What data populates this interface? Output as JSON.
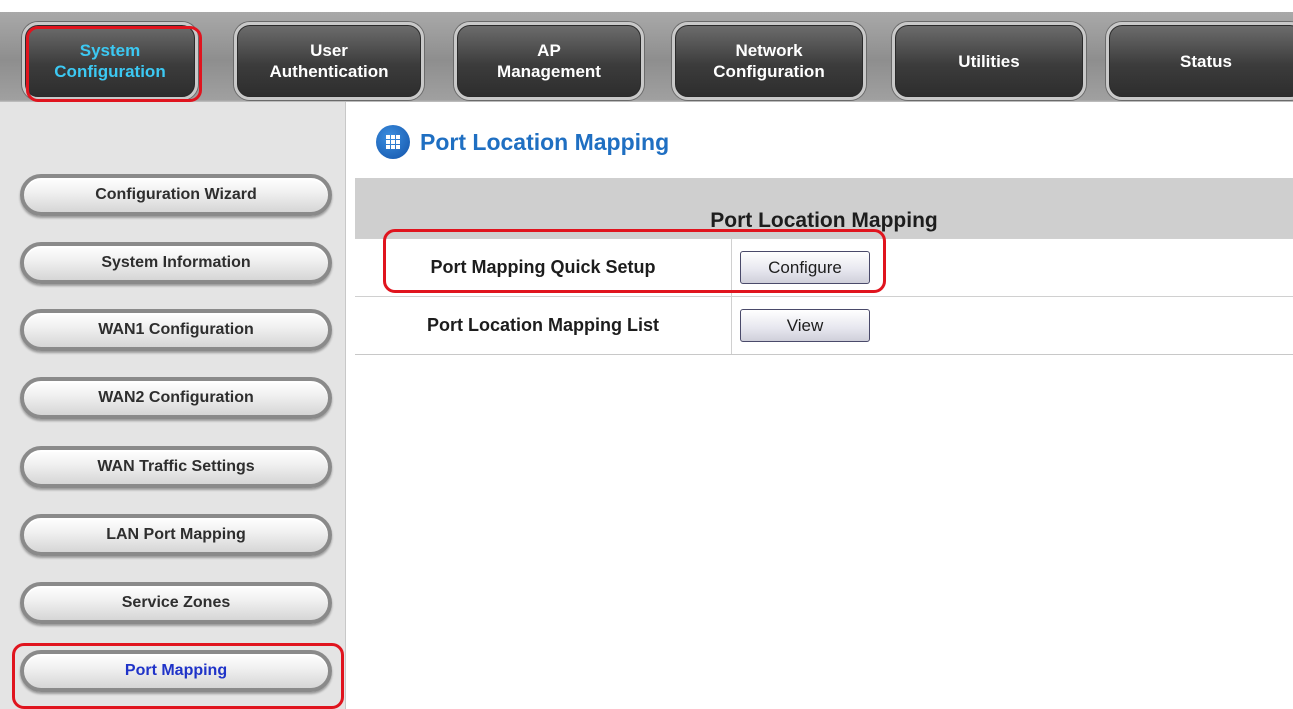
{
  "top_tabs": [
    {
      "label": "System\nConfiguration",
      "active": true
    },
    {
      "label": "User\nAuthentication",
      "active": false
    },
    {
      "label": "AP\nManagement",
      "active": false
    },
    {
      "label": "Network\nConfiguration",
      "active": false
    },
    {
      "label": "Utilities",
      "active": false
    },
    {
      "label": "Status",
      "active": false
    }
  ],
  "sidebar": {
    "items": [
      {
        "label": "Configuration Wizard"
      },
      {
        "label": "System Information"
      },
      {
        "label": "WAN1 Configuration"
      },
      {
        "label": "WAN2 Configuration"
      },
      {
        "label": "WAN Traffic Settings"
      },
      {
        "label": "LAN Port Mapping"
      },
      {
        "label": "Service Zones"
      },
      {
        "label": "Port Mapping",
        "active": true
      }
    ]
  },
  "main": {
    "page_title": "Port Location Mapping",
    "table_header": "Port Location Mapping",
    "rows": [
      {
        "label": "Port Mapping Quick Setup",
        "button": "Configure"
      },
      {
        "label": "Port Location Mapping List",
        "button": "View"
      }
    ]
  },
  "colors": {
    "active_tab_text": "#3cc9f3",
    "active_sidebar_text": "#1f33c8",
    "title_blue": "#1f6fc2",
    "highlight_red": "#e0141e"
  }
}
